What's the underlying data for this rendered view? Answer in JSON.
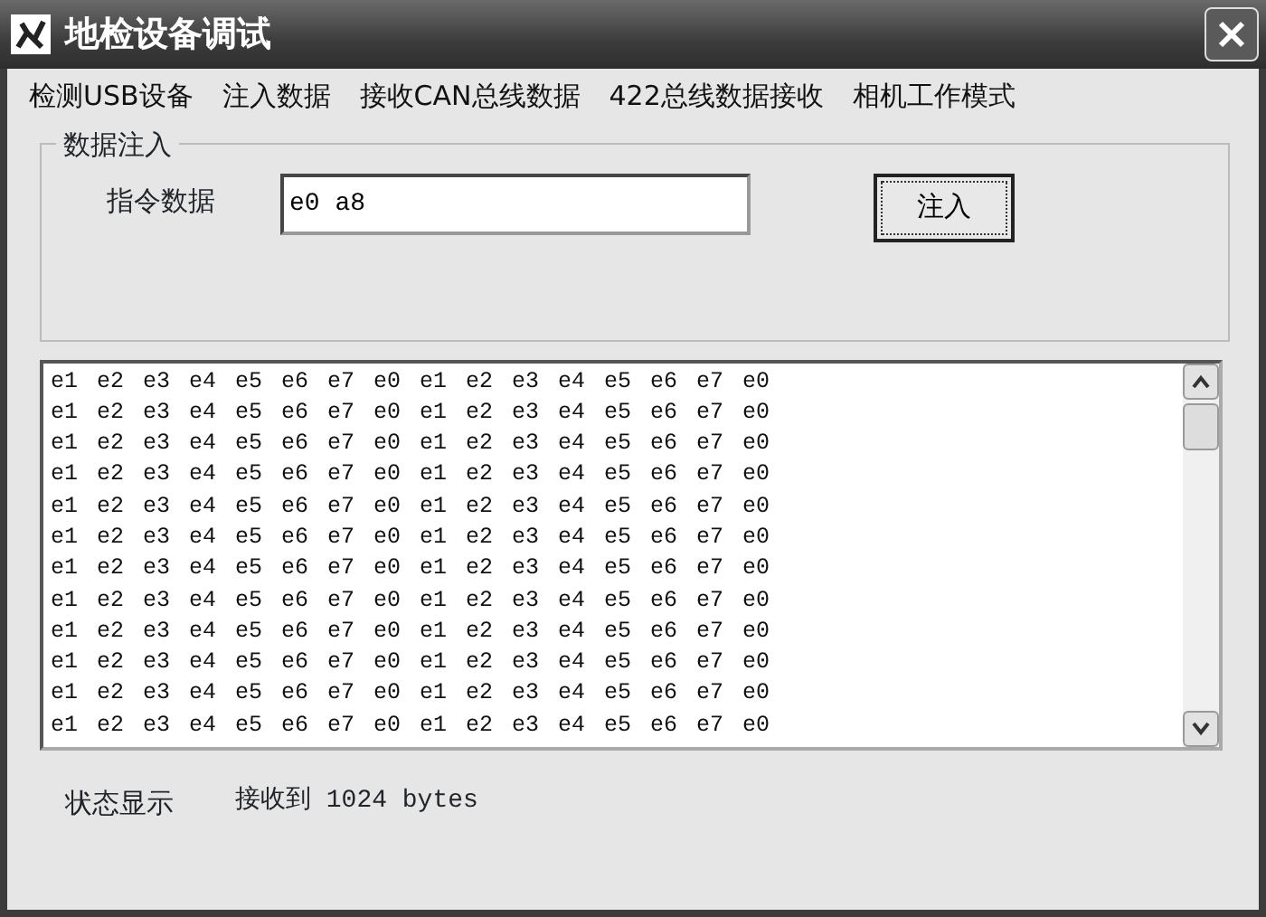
{
  "window": {
    "title": "地检设备调试"
  },
  "menu": [
    {
      "label": "检测USB设备"
    },
    {
      "label": "注入数据"
    },
    {
      "label": "接收CAN总线数据"
    },
    {
      "label": "422总线数据接收"
    },
    {
      "label": "相机工作模式"
    }
  ],
  "inject_group": {
    "title": "数据注入",
    "field_label": "指令数据",
    "value": "e0 a8",
    "button": "注入"
  },
  "received_lines": [
    "e1 e2 e3 e4 e5 e6 e7 e0 e1 e2 e3 e4 e5 e6 e7 e0",
    "e1 e2 e3 e4 e5 e6 e7 e0 e1 e2 e3 e4 e5 e6 e7 e0",
    "e1 e2 e3 e4 e5 e6 e7 e0 e1 e2 e3 e4 e5 e6 e7 e0",
    "e1 e2 e3 e4 e5 e6 e7 e0 e1 e2 e3 e4 e5 e6 e7 e0",
    "e1 e2 e3 e4 e5 e6 e7 e0 e1 e2 e3 e4 e5 e6 e7 e0",
    "e1 e2 e3 e4 e5 e6 e7 e0 e1 e2 e3 e4 e5 e6 e7 e0",
    "e1 e2 e3 e4 e5 e6 e7 e0 e1 e2 e3 e4 e5 e6 e7 e0",
    "e1 e2 e3 e4 e5 e6 e7 e0 e1 e2 e3 e4 e5 e6 e7 e0",
    "e1 e2 e3 e4 e5 e6 e7 e0 e1 e2 e3 e4 e5 e6 e7 e0",
    "e1 e2 e3 e4 e5 e6 e7 e0 e1 e2 e3 e4 e5 e6 e7 e0",
    "e1 e2 e3 e4 e5 e6 e7 e0 e1 e2 e3 e4 e5 e6 e7 e0",
    "e1 e2 e3 e4 e5 e6 e7 e0 e1 e2 e3 e4 e5 e6 e7 e0"
  ],
  "status": {
    "label": "状态显示",
    "text": "接收到 1024 bytes"
  }
}
